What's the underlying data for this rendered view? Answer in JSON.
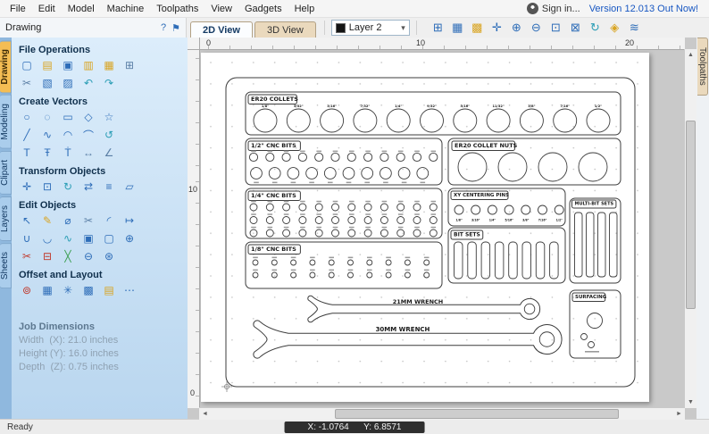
{
  "menu": {
    "items": [
      {
        "label": "File",
        "name": "menu-file"
      },
      {
        "label": "Edit",
        "name": "menu-edit"
      },
      {
        "label": "Model",
        "name": "menu-model"
      },
      {
        "label": "Machine",
        "name": "menu-machine"
      },
      {
        "label": "Toolpaths",
        "name": "menu-toolpaths"
      },
      {
        "label": "View",
        "name": "menu-view"
      },
      {
        "label": "Gadgets",
        "name": "menu-gadgets"
      },
      {
        "label": "Help",
        "name": "menu-help"
      }
    ],
    "sign_in": "Sign in...",
    "version": "Version 12.013 Out Now!"
  },
  "view_tabs": [
    "2D View",
    "3D View"
  ],
  "toolbar": {
    "layer": "Layer 2",
    "help_icon": "?",
    "pin_icon": "⚑",
    "icons": [
      {
        "name": "job-setup-icon",
        "glyph": "⊞",
        "color": "#2e6db8"
      },
      {
        "name": "grid-icon",
        "glyph": "▦",
        "color": "#2e6db8"
      },
      {
        "name": "snap-grid-icon",
        "glyph": "▩",
        "color": "#d9a421"
      },
      {
        "name": "pan-icon",
        "glyph": "✛",
        "color": "#2e6db8"
      },
      {
        "name": "zoom-in-icon",
        "glyph": "⊕",
        "color": "#2e6db8"
      },
      {
        "name": "zoom-out-icon",
        "glyph": "⊖",
        "color": "#2e6db8"
      },
      {
        "name": "zoom-window-icon",
        "glyph": "⊡",
        "color": "#2e6db8"
      },
      {
        "name": "zoom-extents-icon",
        "glyph": "⊠",
        "color": "#2e6db8"
      },
      {
        "name": "refresh-view-icon",
        "glyph": "↻",
        "color": "#2a9db5"
      },
      {
        "name": "wireframe-icon",
        "glyph": "◈",
        "color": "#d9a421"
      },
      {
        "name": "toolpath-preview-icon",
        "glyph": "≋",
        "color": "#2e6db8"
      }
    ]
  },
  "side_tabs": [
    "Drawing",
    "Modeling",
    "Clipart",
    "Layers",
    "Sheets"
  ],
  "right_tab": "Toolpaths",
  "panel": {
    "title": "Drawing",
    "sections": [
      {
        "title": "File Operations",
        "rows": [
          [
            {
              "name": "new-file-icon",
              "glyph": "▢",
              "color": "#2e6db8"
            },
            {
              "name": "open-file-icon",
              "glyph": "▤",
              "color": "#d9a421"
            },
            {
              "name": "save-file-icon",
              "glyph": "▣",
              "color": "#2e6db8"
            },
            {
              "name": "import-vectors-icon",
              "glyph": "▥",
              "color": "#d9a421"
            },
            {
              "name": "export-vectors-icon",
              "glyph": "▦",
              "color": "#d9a421"
            },
            {
              "name": "print-icon",
              "glyph": "⊞",
              "color": "#5b7fa6"
            }
          ],
          [
            {
              "name": "cut-icon",
              "glyph": "✂",
              "color": "#5b7fa6"
            },
            {
              "name": "copy-icon",
              "glyph": "▧",
              "color": "#2e6db8"
            },
            {
              "name": "paste-icon",
              "glyph": "▨",
              "color": "#2e6db8"
            },
            {
              "name": "undo-icon",
              "glyph": "↶",
              "color": "#2a9db5"
            },
            {
              "name": "redo-icon",
              "glyph": "↷",
              "color": "#2a9db5"
            }
          ]
        ]
      },
      {
        "title": "Create Vectors",
        "rows": [
          [
            {
              "name": "draw-circle-icon",
              "glyph": "○",
              "color": "#2e6db8"
            },
            {
              "name": "draw-ellipse-icon",
              "glyph": "◌",
              "color": "#2e6db8"
            },
            {
              "name": "draw-rectangle-icon",
              "glyph": "▭",
              "color": "#2e6db8"
            },
            {
              "name": "draw-polygon-icon",
              "glyph": "◇",
              "color": "#2e6db8"
            },
            {
              "name": "draw-star-icon",
              "glyph": "☆",
              "color": "#2e6db8"
            }
          ],
          [
            {
              "name": "draw-line-icon",
              "glyph": "╱",
              "color": "#2e6db8"
            },
            {
              "name": "draw-polyline-icon",
              "glyph": "∿",
              "color": "#2e6db8"
            },
            {
              "name": "draw-arc-icon",
              "glyph": "◠",
              "color": "#2e6db8"
            },
            {
              "name": "three-point-arc-icon",
              "glyph": "⌒",
              "color": "#2e6db8"
            },
            {
              "name": "draw-spiral-icon",
              "glyph": "↺",
              "color": "#2a9db5"
            }
          ],
          [
            {
              "name": "draw-text-icon",
              "glyph": "T",
              "color": "#2e6db8"
            },
            {
              "name": "text-box-icon",
              "glyph": "Ŧ",
              "color": "#2e6db8"
            },
            {
              "name": "text-on-curve-icon",
              "glyph": "Ṫ",
              "color": "#2e6db8"
            },
            {
              "name": "dimension-icon",
              "glyph": "↔",
              "color": "#5b7fa6"
            },
            {
              "name": "angle-dimension-icon",
              "glyph": "∠",
              "color": "#5b7fa6"
            }
          ]
        ]
      },
      {
        "title": "Transform Objects",
        "rows": [
          [
            {
              "name": "move-selection-icon",
              "glyph": "✛",
              "color": "#2e6db8"
            },
            {
              "name": "set-size-icon",
              "glyph": "⊡",
              "color": "#2e6db8"
            },
            {
              "name": "rotate-icon",
              "glyph": "↻",
              "color": "#2a9db5"
            },
            {
              "name": "mirror-icon",
              "glyph": "⇄",
              "color": "#2e6db8"
            },
            {
              "name": "alignment-icon",
              "glyph": "≡",
              "color": "#2e6db8"
            },
            {
              "name": "distort-icon",
              "glyph": "▱",
              "color": "#2e6db8"
            }
          ]
        ]
      },
      {
        "title": "Edit Objects",
        "rows": [
          [
            {
              "name": "select-tool-icon",
              "glyph": "↖",
              "color": "#2e6db8"
            },
            {
              "name": "node-edit-icon",
              "glyph": "✎",
              "color": "#d9a421"
            },
            {
              "name": "measure-tool-icon",
              "glyph": "⌀",
              "color": "#2e6db8"
            },
            {
              "name": "scissors-tool-icon",
              "glyph": "✂",
              "color": "#5b7fa6"
            },
            {
              "name": "fillet-tool-icon",
              "glyph": "◜",
              "color": "#2e6db8"
            },
            {
              "name": "extend-tool-icon",
              "glyph": "↦",
              "color": "#2e6db8"
            }
          ],
          [
            {
              "name": "join-vectors-icon",
              "glyph": "∪",
              "color": "#2e6db8"
            },
            {
              "name": "close-vector-icon",
              "glyph": "◡",
              "color": "#2e6db8"
            },
            {
              "name": "curve-fit-icon",
              "glyph": "∿",
              "color": "#2a9db5"
            },
            {
              "name": "group-icon",
              "glyph": "▣",
              "color": "#2e6db8"
            },
            {
              "name": "ungroup-icon",
              "glyph": "▢",
              "color": "#2e6db8"
            },
            {
              "name": "weld-vectors-icon",
              "glyph": "⊕",
              "color": "#2e6db8"
            }
          ],
          [
            {
              "name": "trim-vectors-icon",
              "glyph": "✂",
              "color": "#c0392b"
            },
            {
              "name": "crop-vectors-icon",
              "glyph": "⊟",
              "color": "#c0392b"
            },
            {
              "name": "slice-vectors-icon",
              "glyph": "╳",
              "color": "#3a9e4f"
            },
            {
              "name": "boolean-subtract-icon",
              "glyph": "⊖",
              "color": "#2e6db8"
            },
            {
              "name": "boolean-merge-icon",
              "glyph": "⊛",
              "color": "#2e6db8"
            }
          ]
        ]
      },
      {
        "title": "Offset and Layout",
        "rows": [
          [
            {
              "name": "offset-vectors-icon",
              "glyph": "⊚",
              "color": "#c0392b"
            },
            {
              "name": "array-copy-icon",
              "glyph": "▦",
              "color": "#2e6db8"
            },
            {
              "name": "circular-copy-icon",
              "glyph": "✳",
              "color": "#2e6db8"
            },
            {
              "name": "nesting-icon",
              "glyph": "▩",
              "color": "#2e6db8"
            },
            {
              "name": "layout-icon",
              "glyph": "▤",
              "color": "#d9a421"
            },
            {
              "name": "copy-along-vector-icon",
              "glyph": "⋯",
              "color": "#2e6db8"
            }
          ]
        ]
      }
    ],
    "job": {
      "title": "Job Dimensions",
      "lines": [
        "Width  (X): 21.0 inches",
        "Height (Y): 16.0 inches",
        "Depth  (Z): 0.75 inches"
      ]
    }
  },
  "rulers": {
    "h": [
      "0",
      "10",
      "20"
    ],
    "v": [
      "10",
      "0"
    ]
  },
  "drawing": {
    "er20_collets": {
      "title": "ER20 COLLETS",
      "labels": [
        "1/8\"",
        "5/32\"",
        "3/16\"",
        "7/32\"",
        "1/4\"",
        "9/32\"",
        "5/16\"",
        "11/32\"",
        "3/8\"",
        "7/16\"",
        "1/2\""
      ]
    },
    "half_inch_bits": {
      "title": "1/2\" CNC BITS",
      "row1": 12,
      "row2": 10
    },
    "collet_nuts": {
      "title": "ER20 COLLET NUTS",
      "count": 4
    },
    "quarter_inch_bits": {
      "title": "1/4\" CNC BITS",
      "rows": 3,
      "per_row": 12
    },
    "xy_pins": {
      "title": "XY CENTERING PINS",
      "labels": [
        "1/8\"",
        "3/16\"",
        "1/4\"",
        "5/16\"",
        "3/8\"",
        "7/16\"",
        "1/2\""
      ]
    },
    "multi_bit_sets": {
      "title": "MULTI-BIT SETS",
      "slots": 4
    },
    "bit_sets": {
      "title": "BIT SETS",
      "slots": 8
    },
    "eighth_inch_bits": {
      "title": "1/8\" CNC BITS",
      "rows": 2,
      "per_row": 10
    },
    "wrench_21": {
      "label": "21MM WRENCH"
    },
    "wrench_30": {
      "label": "30MM WRENCH"
    },
    "surfacing": {
      "title": "SURFACING"
    }
  },
  "status": {
    "ready": "Ready",
    "coords": "X: -1.0764      Y: 6.8571"
  }
}
